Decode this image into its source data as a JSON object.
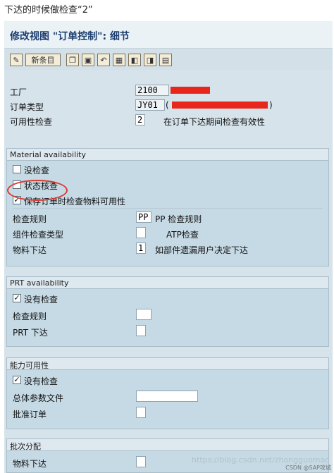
{
  "caption": "下达的时候做检查“2”",
  "window": {
    "title": "修改视图 \"订单控制\": 细节"
  },
  "toolbar": {
    "new_entries_label": "新条目",
    "icons": [
      "edit-icon",
      "copy-icon",
      "delete-icon",
      "undo-icon",
      "select-icon",
      "prev-icon",
      "next-icon",
      "doc-icon"
    ]
  },
  "header_fields": {
    "plant_label": "工厂",
    "plant_value": "2100",
    "order_type_label": "订单类型",
    "order_type_value": "JY01",
    "order_type_paren_open": "(",
    "order_type_paren_close": ")",
    "availability_check_label": "可用性检查",
    "availability_check_value": "2",
    "availability_check_desc": "在订单下达期间检查有效性"
  },
  "material_group": {
    "title": "Material availability",
    "no_check_label": "没检查",
    "status_check_label": "状态核查",
    "check_on_save_label": "保存订单时检查物料可用性",
    "check_on_save_checked": "✓",
    "check_rule_label": "检查规则",
    "check_rule_value": "PP",
    "check_rule_desc": "PP 检查规则",
    "component_check_type_label": "组件检查类型",
    "component_check_type_desc": "ATP检查",
    "material_release_label": "物料下达",
    "material_release_value": "1",
    "material_release_desc": "如部件遗漏用户决定下达"
  },
  "prt_group": {
    "title": "PRT availability",
    "no_check_label": "没有检查",
    "no_check_checked": "✓",
    "check_rule_label": "检查规则",
    "prt_release_label": "PRT 下达"
  },
  "capacity_group": {
    "title": "能力可用性",
    "no_check_label": "没有检查",
    "no_check_checked": "✓",
    "overall_profile_label": "总体参数文件",
    "release_order_label": "批准订单"
  },
  "batch_group": {
    "title": "批次分配",
    "material_release_label": "物料下达"
  },
  "watermark": "https://blog.csdn.net/zhongguomao",
  "watermark_small": "CSDN @SAP攻城"
}
